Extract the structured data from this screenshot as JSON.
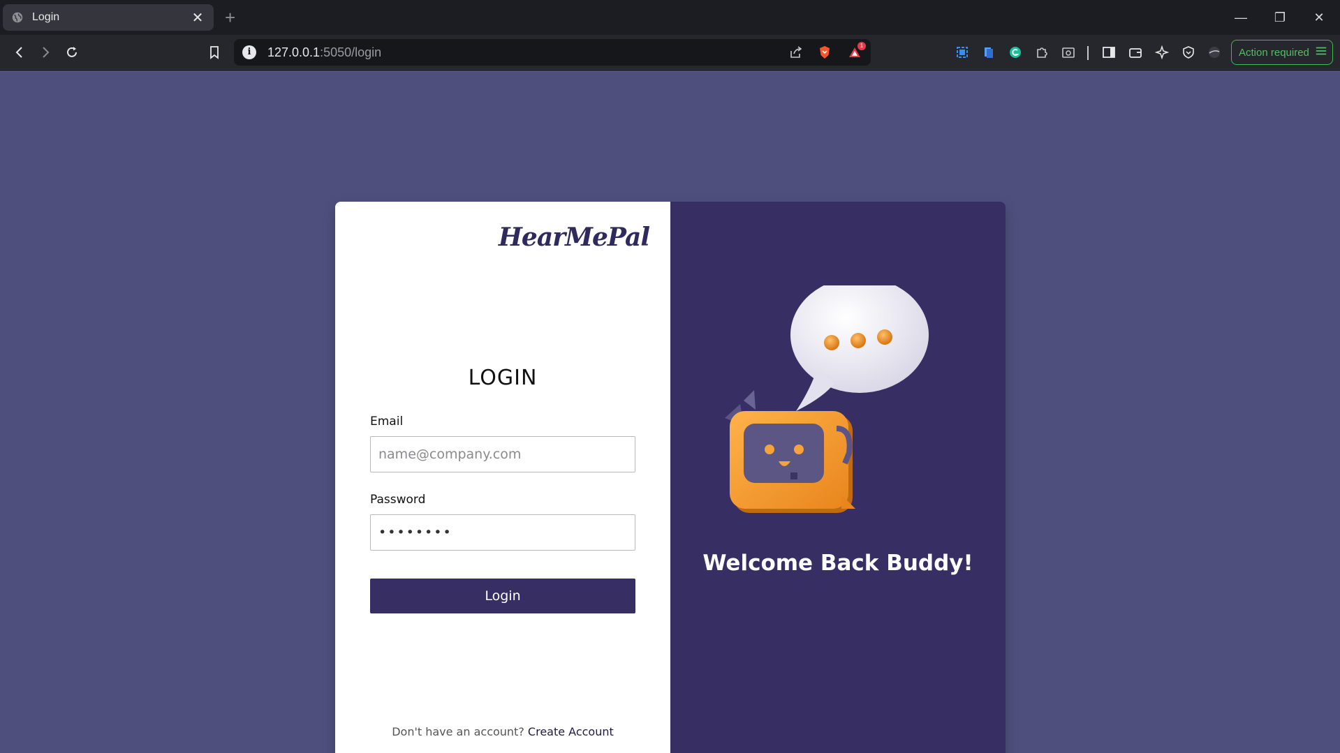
{
  "browser": {
    "tab": {
      "title": "Login",
      "close_glyph": "✕"
    },
    "new_tab_glyph": "+",
    "url": {
      "host": "127.0.0.1",
      "rest": ":5050/login"
    },
    "action_button": "Action required",
    "notification_count": "1",
    "window_controls": {
      "minimize": "—",
      "restore": "❐",
      "close": "✕"
    }
  },
  "brand": "HearMePal",
  "form": {
    "title": "LOGIN",
    "email": {
      "label": "Email",
      "placeholder": "name@company.com",
      "value": ""
    },
    "password": {
      "label": "Password",
      "value": "••••••••"
    },
    "submit": "Login",
    "signup_prompt": "Don't have an account?",
    "signup_link": "Create Account"
  },
  "welcome": "Welcome Back Buddy!",
  "colors": {
    "page_bg": "#4f4f7d",
    "panel_dark": "#372e63",
    "brand": "#2f2a5e",
    "robot_orange": "#f4a037",
    "action_green": "#3fb950"
  },
  "icons": [
    "globe-icon",
    "back-icon",
    "forward-icon",
    "reload-icon",
    "bookmark-icon",
    "info-icon",
    "share-icon",
    "brave-shield-icon",
    "rewards-icon",
    "extension-icons",
    "sidebar-icon",
    "wallet-icon",
    "leo-icon",
    "vpn-icon",
    "menu-icon"
  ]
}
